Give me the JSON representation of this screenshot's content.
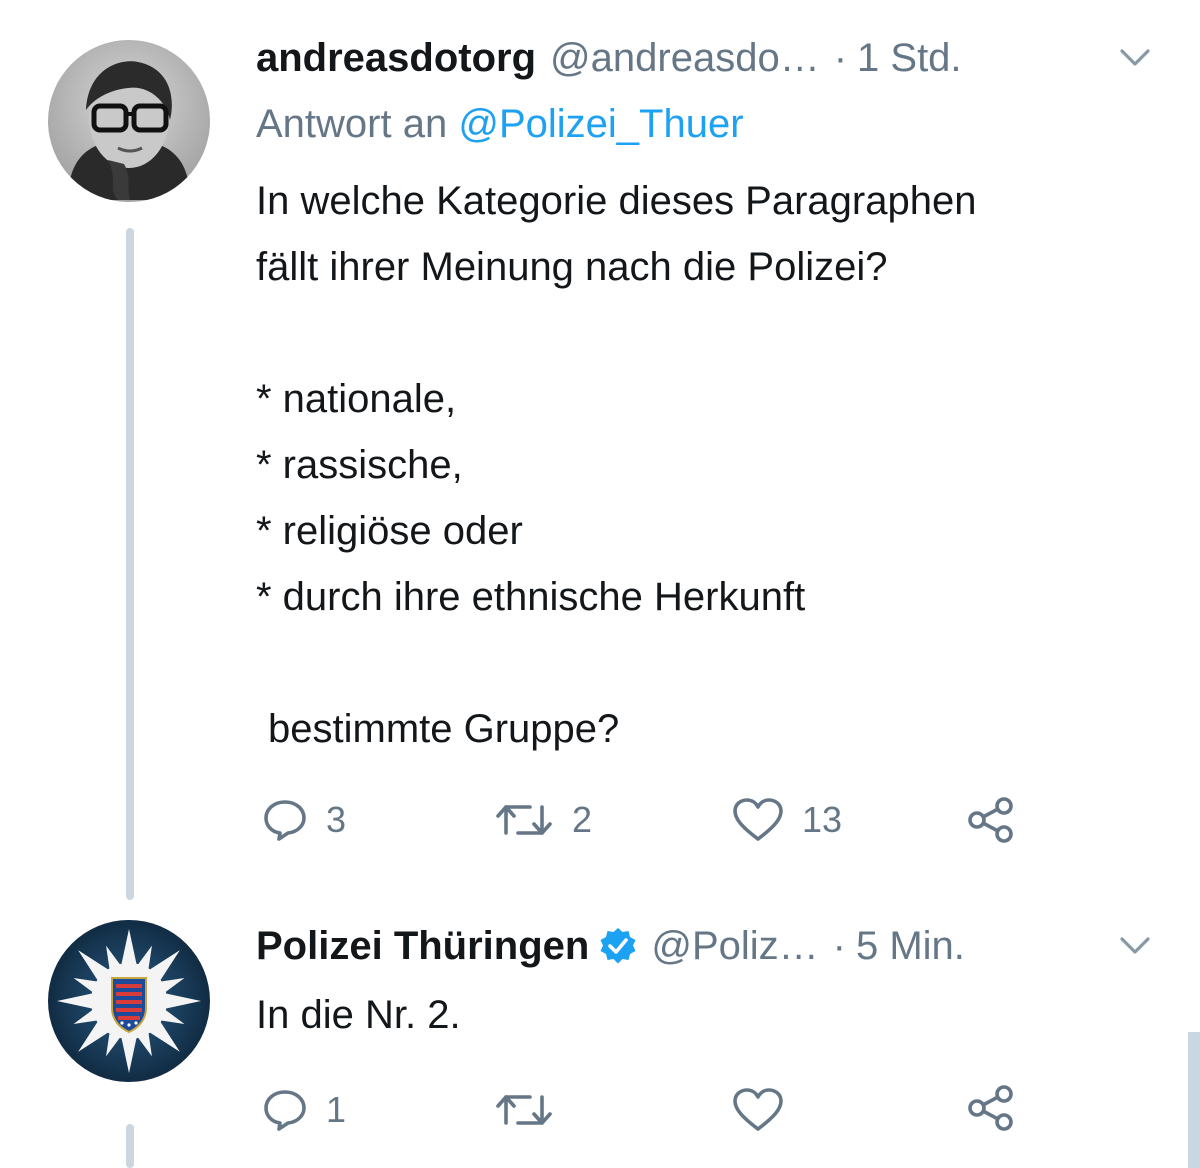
{
  "tweets": [
    {
      "display_name": "andreasdotorg",
      "handle": "@andreasdo…",
      "separator": "·",
      "time": "1 Std.",
      "reply_prefix": "Antwort an",
      "reply_mention": "@Polizei_Thuer",
      "text_lines": [
        "In welche Kategorie dieses Paragraphen",
        "fällt ihrer Meinung nach die Polizei?",
        "* nationale,",
        "* rassische,",
        "* religiöse oder",
        "* durch ihre ethnische Herkunft",
        "bestimmte Gruppe?"
      ],
      "actions": {
        "reply_count": "3",
        "retweet_count": "2",
        "like_count": "13"
      }
    },
    {
      "display_name": "Polizei Thüringen",
      "verified": true,
      "handle": "@Poliz…",
      "separator": "·",
      "time": "5 Min.",
      "text_lines": [
        "In die Nr. 2."
      ],
      "actions": {
        "reply_count": "1",
        "retweet_count": "",
        "like_count": ""
      }
    }
  ],
  "colors": {
    "primary_text": "#14171a",
    "secondary_text": "#657786",
    "link": "#1da1f2",
    "thread_line": "#ccd6dd",
    "verified_badge": "#1da1f2"
  },
  "icons": [
    "reply-icon",
    "retweet-icon",
    "like-icon",
    "share-icon",
    "chevron-down-icon",
    "verified-badge-icon"
  ]
}
